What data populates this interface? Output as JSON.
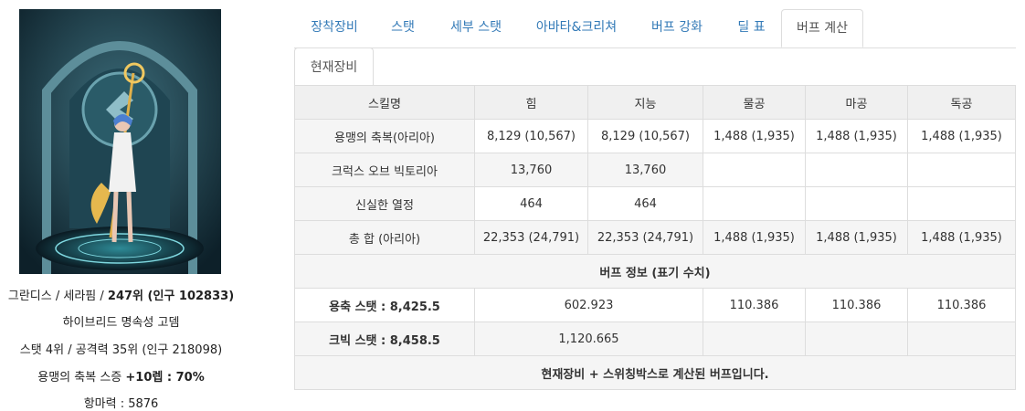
{
  "profile": {
    "line1_server": "그란디스",
    "line1_class": "세라핌",
    "line1_rank": "247위 (인구 102833)",
    "line2": "하이브리드 명속성 고뎀",
    "line3": "스탯 4위 / 공격력 35위 (인구 218098)",
    "line4_prefix": "용맹의 축복 스증",
    "line4_value": "+10렙 : 70%",
    "line5": "항마력 : 5876"
  },
  "tabs": [
    "장착장비",
    "스탯",
    "세부 스탯",
    "아바타&크리쳐",
    "버프 강화",
    "딜 표",
    "버프 계산"
  ],
  "active_tab": "버프 계산",
  "subtabs": [
    "현재장비"
  ],
  "table": {
    "headers": [
      "스킬명",
      "힘",
      "지능",
      "물공",
      "마공",
      "독공"
    ],
    "rows": [
      [
        "용맹의 축복(아리아)",
        "8,129 (10,567)",
        "8,129 (10,567)",
        "1,488 (1,935)",
        "1,488 (1,935)",
        "1,488 (1,935)"
      ],
      [
        "크럭스 오브 빅토리아",
        "13,760",
        "13,760",
        "",
        "",
        ""
      ],
      [
        "신실한 열정",
        "464",
        "464",
        "",
        "",
        ""
      ],
      [
        "총 합 (아리아)",
        "22,353 (24,791)",
        "22,353 (24,791)",
        "1,488 (1,935)",
        "1,488 (1,935)",
        "1,488 (1,935)"
      ]
    ],
    "section_title": "버프 정보 (표기 수치)",
    "info_rows": [
      {
        "label": "용축 스탯 : 8,425.5",
        "stat": "602.923",
        "phys": "110.386",
        "mag": "110.386",
        "indep": "110.386"
      },
      {
        "label": "크빅 스탯 : 8,458.5",
        "stat": "1,120.665",
        "phys": "",
        "mag": "",
        "indep": ""
      }
    ],
    "footer": "현재장비 + 스위칭박스로 계산된 버프입니다."
  }
}
